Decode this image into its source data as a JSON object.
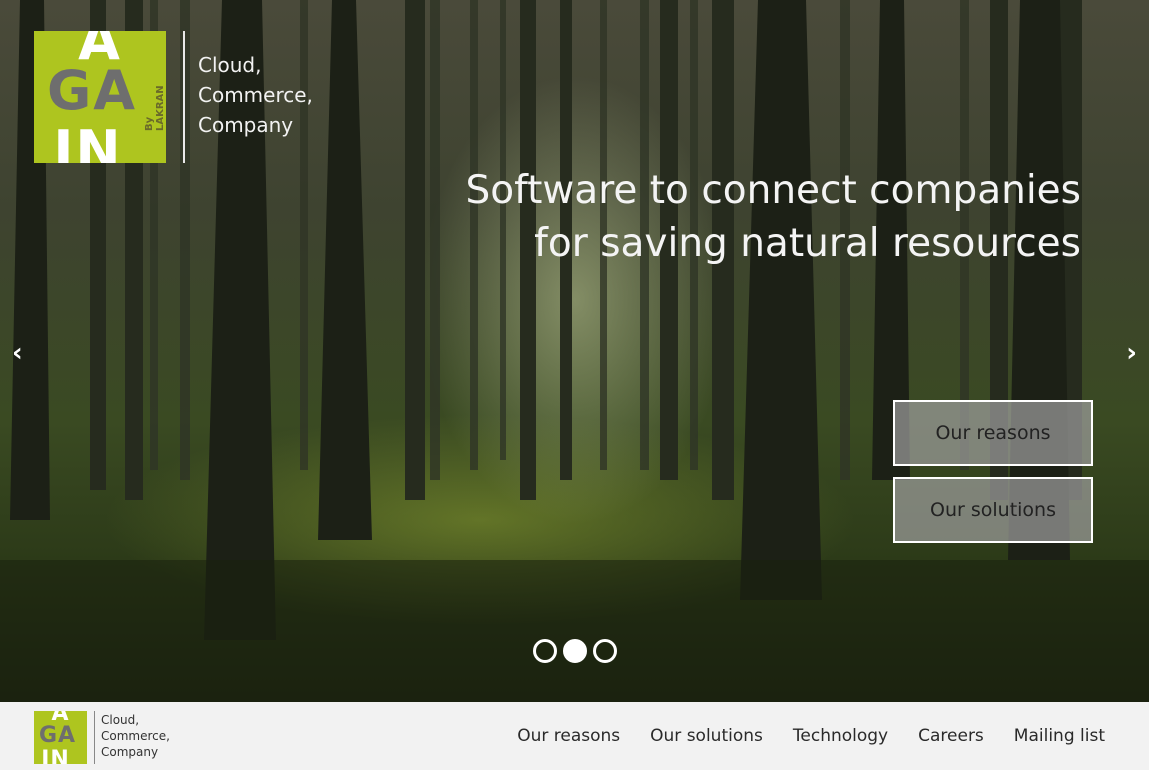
{
  "brand": {
    "logo_letters": [
      "A",
      "GA",
      "IN"
    ],
    "logo_byline": "By LAKRAN",
    "tagline": [
      "Cloud,",
      "Commerce,",
      "Company"
    ],
    "accent_color": "#aec51f"
  },
  "hero": {
    "headline_line1": "Software to connect companies",
    "headline_line2": "for saving natural resources",
    "prev_arrow": "‹",
    "next_arrow": "›",
    "buttons": {
      "reasons": "Our reasons",
      "solutions": "Our solutions"
    },
    "slide_indicators": {
      "count": 3,
      "active_index": 1
    }
  },
  "nav": {
    "items": [
      "Our reasons",
      "Our solutions",
      "Technology",
      "Careers",
      "Mailing list"
    ]
  }
}
